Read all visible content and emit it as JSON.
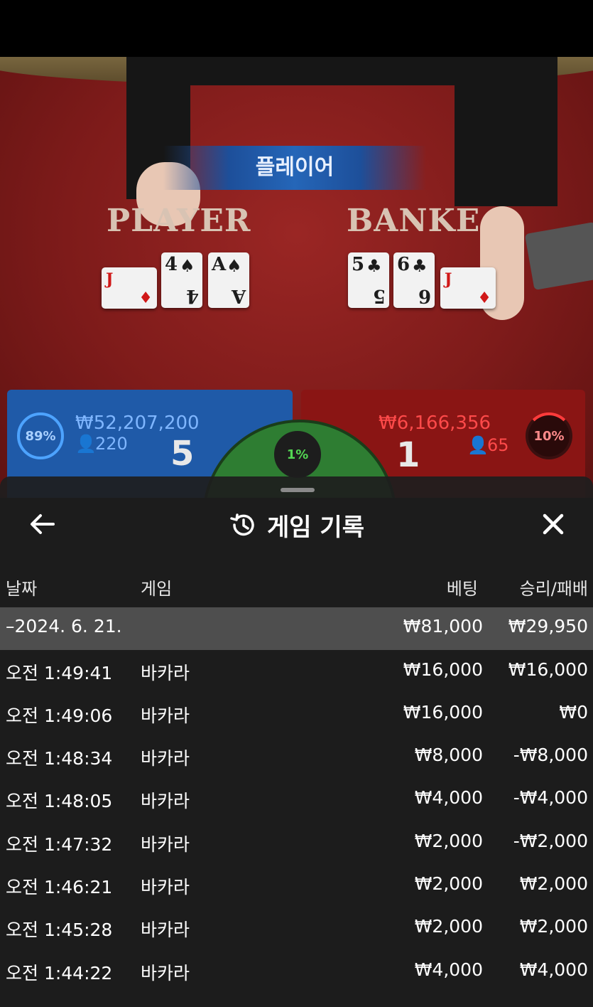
{
  "table": {
    "banner": "플레이어",
    "player_label": "PLAYER",
    "banker_label": "BANKE",
    "player_cards": [
      {
        "rank": "J",
        "suit": "♦",
        "color": "red",
        "sideways": true
      },
      {
        "rank": "4",
        "suit": "♠",
        "color": "black"
      },
      {
        "rank": "A",
        "suit": "♠",
        "color": "black"
      }
    ],
    "banker_cards": [
      {
        "rank": "5",
        "suit": "♣",
        "color": "black"
      },
      {
        "rank": "6",
        "suit": "♣",
        "color": "black"
      },
      {
        "rank": "J",
        "suit": "♦",
        "color": "red",
        "sideways": true
      }
    ]
  },
  "bets": {
    "player": {
      "percent": "89%",
      "amount": "₩52,207,200",
      "players": "220",
      "score": "5",
      "color": "#1f5aa8"
    },
    "tie": {
      "percent": "1%"
    },
    "banker": {
      "percent": "10%",
      "amount": "₩6,166,356",
      "players": "65",
      "score": "1",
      "color": "#8a1514"
    }
  },
  "sheet": {
    "title": "게임 기록",
    "back_icon": "arrow-left-icon",
    "history_icon": "history-clock-icon",
    "close_icon": "close-icon",
    "columns": {
      "date": "날짜",
      "game": "게임",
      "bet": "베팅",
      "result": "승리/패배"
    },
    "summary": {
      "date": "–2024. 6. 21.",
      "bet": "₩81,000",
      "result": "₩29,950"
    },
    "rows": [
      {
        "time": "오전 1:49:41",
        "game": "바카라",
        "bet": "₩16,000",
        "result": "₩16,000"
      },
      {
        "time": "오전 1:49:06",
        "game": "바카라",
        "bet": "₩16,000",
        "result": "₩0"
      },
      {
        "time": "오전 1:48:34",
        "game": "바카라",
        "bet": "₩8,000",
        "result": "-₩8,000"
      },
      {
        "time": "오전 1:48:05",
        "game": "바카라",
        "bet": "₩4,000",
        "result": "-₩4,000"
      },
      {
        "time": "오전 1:47:32",
        "game": "바카라",
        "bet": "₩2,000",
        "result": "-₩2,000"
      },
      {
        "time": "오전 1:46:21",
        "game": "바카라",
        "bet": "₩2,000",
        "result": "₩2,000"
      },
      {
        "time": "오전 1:45:28",
        "game": "바카라",
        "bet": "₩2,000",
        "result": "₩2,000"
      },
      {
        "time": "오전 1:44:22",
        "game": "바카라",
        "bet": "₩4,000",
        "result": "₩4,000"
      }
    ]
  }
}
